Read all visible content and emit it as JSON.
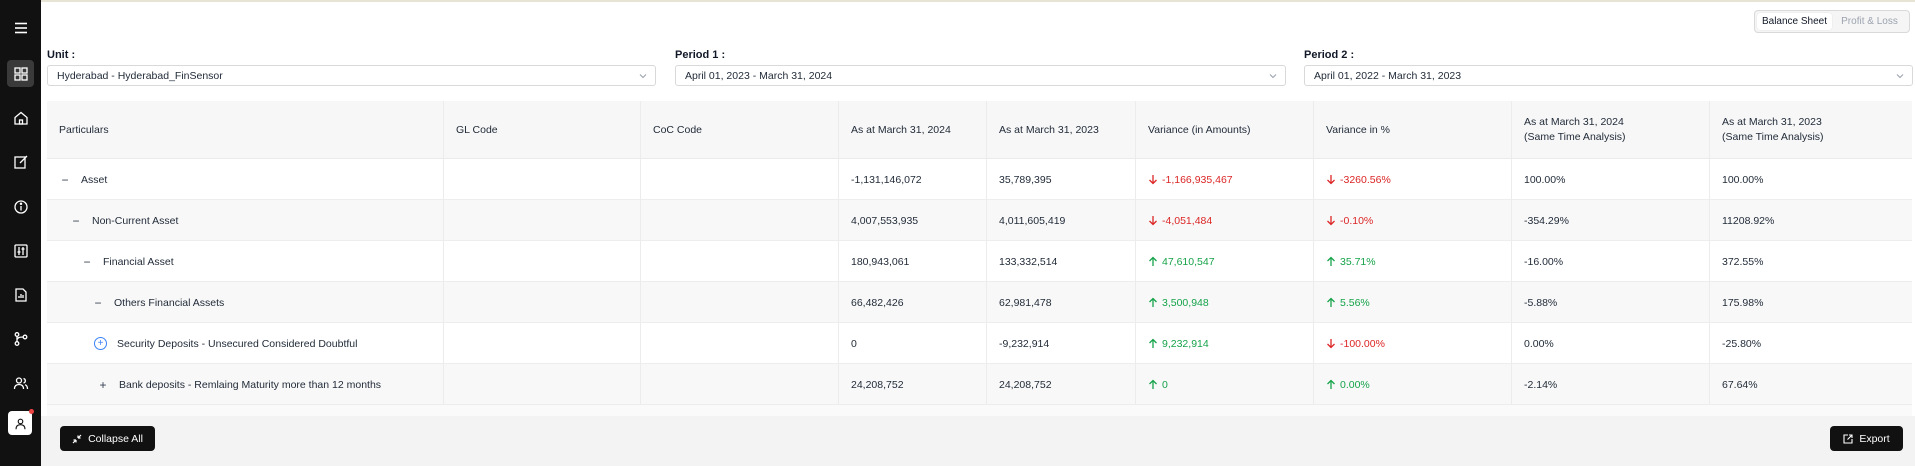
{
  "toggle": {
    "balance_sheet": "Balance Sheet",
    "profit_loss": "Profit & Loss"
  },
  "filters": {
    "unit_label": "Unit :",
    "unit_value": "Hyderabad - Hyderabad_FinSensor",
    "period1_label": "Period 1 :",
    "period1_value": "April 01, 2023 - March 31, 2024",
    "period2_label": "Period 2 :",
    "period2_value": "April 01, 2022 - March 31, 2023"
  },
  "table": {
    "headers": {
      "particulars": "Particulars",
      "gl_code": "GL Code",
      "coc_code": "CoC Code",
      "as_at_2024": "As at March 31, 2024",
      "as_at_2023": "As at March 31, 2023",
      "variance_amt": "Variance (in Amounts)",
      "variance_pct": "Variance in %",
      "sta_2024_line1": "As at March 31, 2024",
      "sta_2024_line2": "(Same Time Analysis)",
      "sta_2023_line1": "As at March 31, 2023",
      "sta_2023_line2": "(Same Time Analysis)"
    },
    "rows": [
      {
        "particular": "Asset",
        "expander": "−",
        "gl": "",
        "coc": "",
        "y2024": "-1,131,146,072",
        "y2023": "35,789,395",
        "var_amt": "-1,166,935,467",
        "var_pct": "-3260.56%",
        "trend": "down",
        "sta2024": "100.00%",
        "sta2023": "100.00%"
      },
      {
        "particular": "Non-Current Asset",
        "expander": "−",
        "gl": "",
        "coc": "",
        "y2024": "4,007,553,935",
        "y2023": "4,011,605,419",
        "var_amt": "-4,051,484",
        "var_pct": "-0.10%",
        "trend": "down",
        "sta2024": "-354.29%",
        "sta2023": "11208.92%"
      },
      {
        "particular": "Financial Asset",
        "expander": "−",
        "gl": "",
        "coc": "",
        "y2024": "180,943,061",
        "y2023": "133,332,514",
        "var_amt": "47,610,547",
        "var_pct": "35.71%",
        "trend": "up",
        "sta2024": "-16.00%",
        "sta2023": "372.55%"
      },
      {
        "particular": "Others Financial Assets",
        "expander": "−",
        "gl": "",
        "coc": "",
        "y2024": "66,482,426",
        "y2023": "62,981,478",
        "var_amt": "3,500,948",
        "var_pct": "5.56%",
        "trend": "up",
        "sta2024": "-5.88%",
        "sta2023": "175.98%"
      },
      {
        "particular": "Security Deposits - Unsecured Considered Doubtful",
        "expander": "+",
        "gl": "",
        "coc": "",
        "y2024": "0",
        "y2023": "-9,232,914",
        "var_amt": "9,232,914",
        "var_pct": "-100.00%",
        "trend": "mixed",
        "sta2024": "0.00%",
        "sta2023": "-25.80%"
      },
      {
        "particular": "Bank deposits - Remlaing Maturity more than 12 months",
        "expander": "+",
        "gl": "",
        "coc": "",
        "y2024": "24,208,752",
        "y2023": "24,208,752",
        "var_amt": "0",
        "var_pct": "0.00%",
        "trend": "up",
        "sta2024": "-2.14%",
        "sta2023": "67.64%"
      }
    ]
  },
  "footer": {
    "collapse_all": "Collapse All",
    "export": "Export"
  },
  "colors": {
    "up": "#16a34a",
    "down": "#dc2626",
    "sidebar": "#111111"
  },
  "sidebar_icons": [
    "menu-icon",
    "dashboard-icon",
    "home-icon",
    "edit-icon",
    "info-icon",
    "sliders-icon",
    "report-icon",
    "workflow-icon",
    "users-icon",
    "user-avatar-icon"
  ]
}
